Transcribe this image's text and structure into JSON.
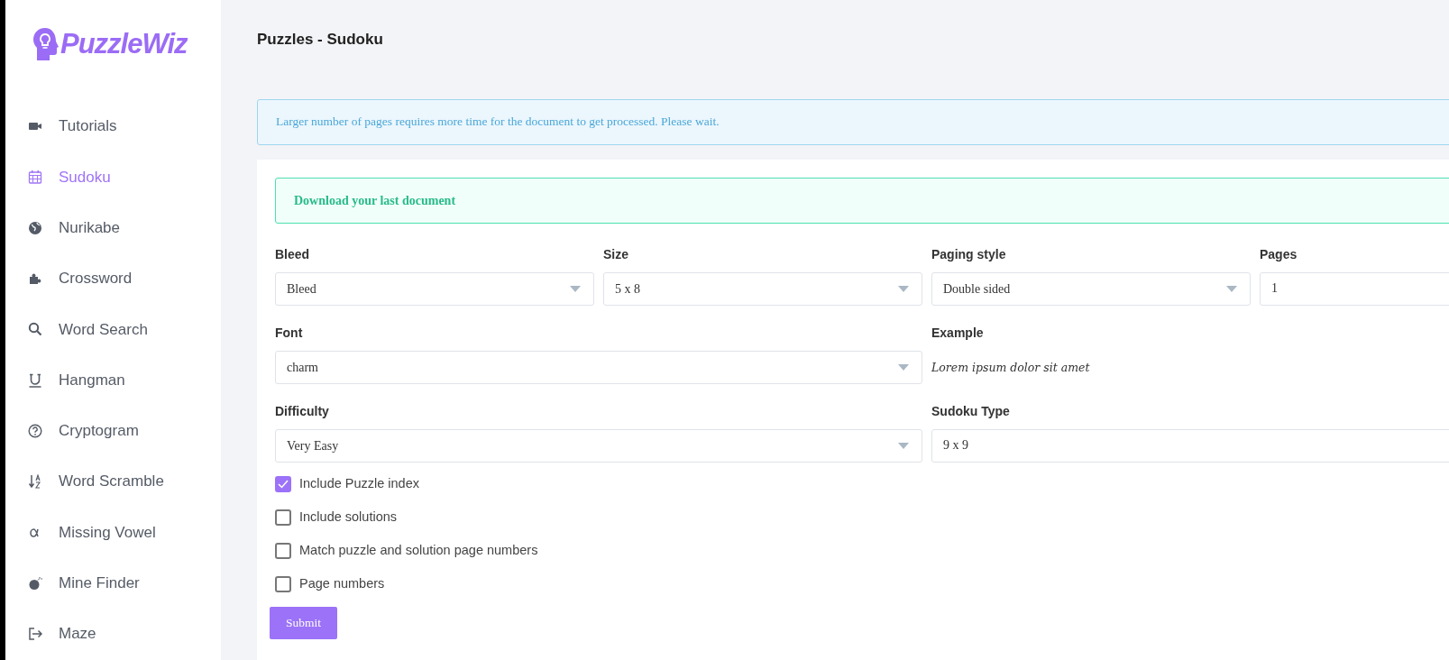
{
  "sidebar": {
    "logo": "PuzzleWiz",
    "items": [
      {
        "label": "Tutorials",
        "selected": false
      },
      {
        "label": "Sudoku",
        "selected": true
      },
      {
        "label": "Nurikabe",
        "selected": false
      },
      {
        "label": "Crossword",
        "selected": false
      },
      {
        "label": "Word Search",
        "selected": false
      },
      {
        "label": "Hangman",
        "selected": false
      },
      {
        "label": "Cryptogram",
        "selected": false
      },
      {
        "label": "Word Scramble",
        "selected": false
      },
      {
        "label": "Missing Vowel",
        "selected": false
      },
      {
        "label": "Mine Finder",
        "selected": false
      },
      {
        "label": "Maze",
        "selected": false
      }
    ]
  },
  "page_title": "Puzzles - Sudoku",
  "info_alert": "Larger number of pages requires more time for the document to get processed. Please wait.",
  "download_alert": "Download your last document",
  "fields": [
    {
      "kind": "select",
      "label": "Bleed",
      "value": "Bleed"
    },
    {
      "kind": "select",
      "label": "Size",
      "value": "5 x 8"
    },
    {
      "kind": "select",
      "label": "Paging style",
      "value": "Double sided"
    },
    {
      "kind": "input",
      "label": "Pages",
      "value": "1"
    },
    {
      "kind": "select",
      "label": "Font",
      "value": "charm"
    },
    {
      "kind": "example",
      "label": "Example",
      "value": "Lorem ipsum dolor sit amet"
    },
    {
      "kind": "select",
      "label": "Difficulty",
      "value": "Very Easy"
    },
    {
      "kind": "input",
      "label": "Sudoku Type",
      "value": "9 x 9"
    }
  ],
  "checkboxes": [
    {
      "label": "Include Puzzle index",
      "checked": true
    },
    {
      "label": "Include solutions",
      "checked": false
    },
    {
      "label": "Match puzzle and solution page numbers",
      "checked": false
    },
    {
      "label": "Page numbers",
      "checked": false
    }
  ],
  "submit": "Submit"
}
